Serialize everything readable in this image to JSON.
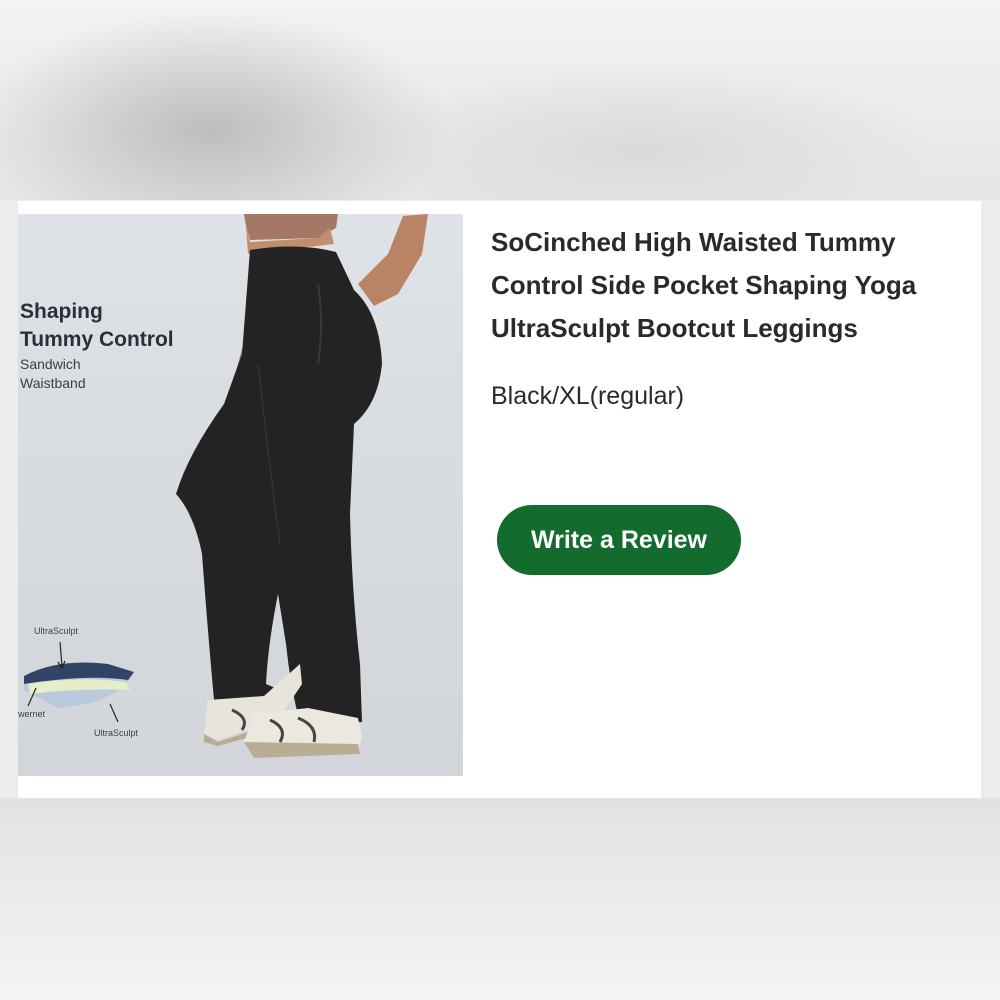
{
  "image_text": {
    "heading_line1": "Shaping",
    "heading_line2": "Tummy Control",
    "sub_line1": "Sandwich",
    "sub_line2": "Waistband",
    "fabric_top": "UltraSculpt",
    "fabric_left": "wernet",
    "fabric_bottom": "UltraSculpt"
  },
  "product": {
    "title_line1": "SoCinched High Waisted Tummy",
    "title_line2": "Control Side Pocket Shaping Yoga",
    "title_line3": "UltraSculpt Bootcut Leggings",
    "variant": "Black/XL(regular)"
  },
  "actions": {
    "review_label": "Write a Review"
  },
  "colors": {
    "button": "#136b2d",
    "image_bg": "#d9dde1",
    "leggings": "#232323"
  }
}
